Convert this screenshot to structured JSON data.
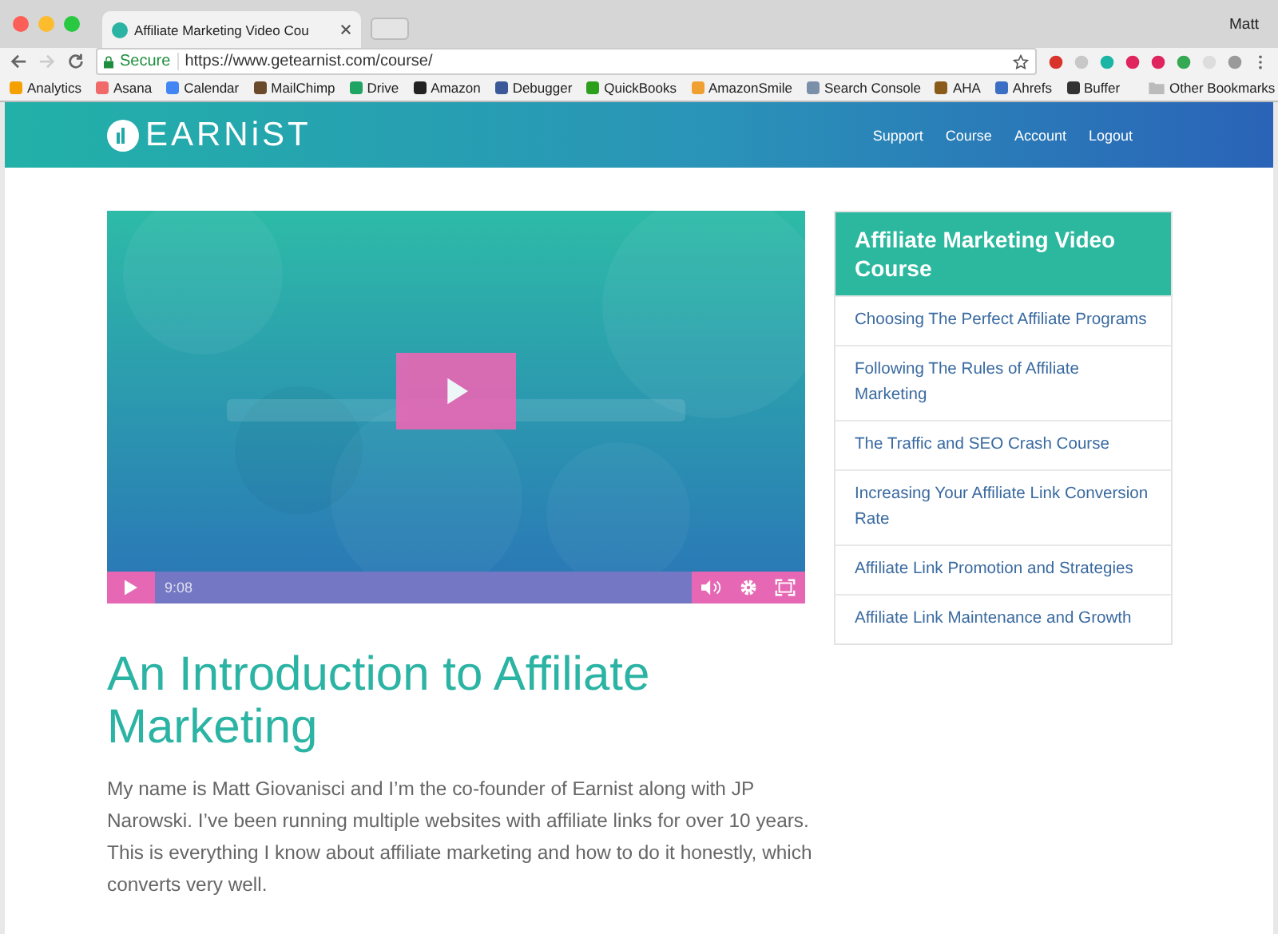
{
  "browser": {
    "tab_title": "Affiliate Marketing Video Cou",
    "user": "Matt",
    "secure_label": "Secure",
    "url": "https://www.getearnist.com/course/",
    "bookmarks": [
      {
        "label": "Analytics",
        "color": "#f4a100"
      },
      {
        "label": "Asana",
        "color": "#f06a6a"
      },
      {
        "label": "Calendar",
        "color": "#4285f4"
      },
      {
        "label": "MailChimp",
        "color": "#6b4a2b"
      },
      {
        "label": "Drive",
        "color": "#1fa463"
      },
      {
        "label": "Amazon",
        "color": "#222222"
      },
      {
        "label": "Debugger",
        "color": "#3b5998"
      },
      {
        "label": "QuickBooks",
        "color": "#2ca01c"
      },
      {
        "label": "AmazonSmile",
        "color": "#f0a030"
      },
      {
        "label": "Search Console",
        "color": "#7a8fa8"
      },
      {
        "label": "AHA",
        "color": "#8a5a1a"
      },
      {
        "label": "Ahrefs",
        "color": "#3b6fc4"
      },
      {
        "label": "Buffer",
        "color": "#333333"
      }
    ],
    "other_bookmarks": "Other Bookmarks"
  },
  "site": {
    "logo": "EARNiST",
    "nav": [
      "Support",
      "Course",
      "Account",
      "Logout"
    ]
  },
  "video": {
    "time": "9:08"
  },
  "course": {
    "title": "Affiliate Marketing Video Course",
    "lessons": [
      "Choosing The Perfect Affiliate Programs",
      "Following The Rules of Affiliate Marketing",
      "The Traffic and SEO Crash Course",
      "Increasing Your Affiliate Link Conversion Rate",
      "Affiliate Link Promotion and Strategies",
      "Affiliate Link Maintenance and Growth"
    ]
  },
  "article": {
    "heading": "An Introduction to Affiliate Marketing",
    "intro": "My name is Matt Giovanisci and I’m the co-founder of Earnist along with JP Narowski. I’ve been running multiple websites with affiliate links for over 10 years. This is everything I know about affiliate marketing and how to do it honestly, which converts very well."
  }
}
